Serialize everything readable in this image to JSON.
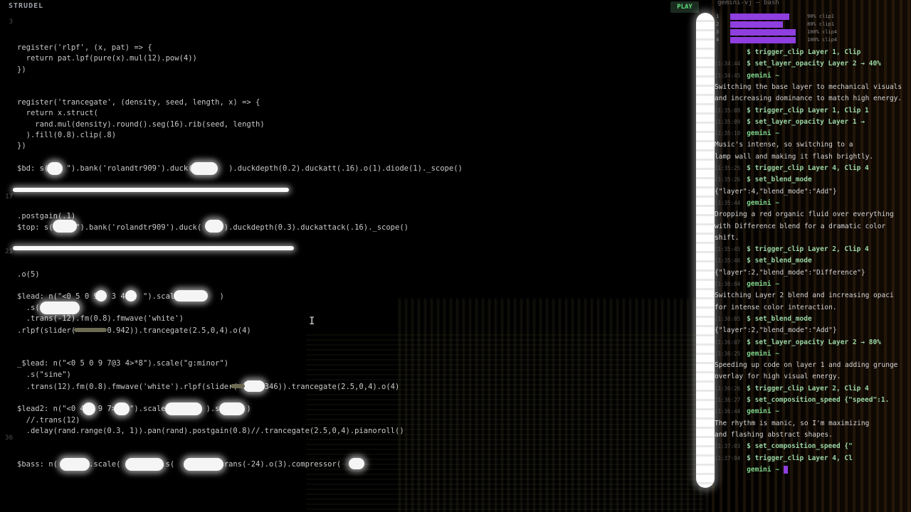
{
  "app": {
    "title": "STRUDEL",
    "play_label": "PLAY"
  },
  "terminal": {
    "title": "gemini-vj — bash",
    "meters": [
      {
        "num": "1",
        "value": 0.9,
        "label": "90% clip1"
      },
      {
        "num": "2",
        "value": 0.8,
        "label": "80% clip1"
      },
      {
        "num": "3",
        "value": 1.0,
        "label": "100% clip4"
      },
      {
        "num": "4",
        "value": 1.0,
        "label": "100% clip4"
      }
    ],
    "lines": [
      {
        "ts": "",
        "kind": "cmd",
        "text": "$ trigger_clip Layer 1, Clip"
      },
      {
        "ts": "11:34:44",
        "kind": "cmd",
        "text": "$ set_layer_opacity Layer 2 → 40%"
      },
      {
        "ts": "11:34:45",
        "kind": "prompt",
        "text": "gemini ~"
      },
      {
        "ts": "",
        "kind": "msg",
        "text": "Switching the base layer to mechanical visuals"
      },
      {
        "ts": "",
        "kind": "msg",
        "text": "and increasing dominance to match high energy."
      },
      {
        "ts": "11:35:08",
        "kind": "cmd",
        "text": "$ trigger_clip Layer 1, Clip 1"
      },
      {
        "ts": "11:35:09",
        "kind": "cmd",
        "text": "$ set_layer_opacity Layer 1 →"
      },
      {
        "ts": "11:35:10",
        "kind": "prompt",
        "text": "gemini ~"
      },
      {
        "ts": "",
        "kind": "msg",
        "text": "Music's intense, so switching to a"
      },
      {
        "ts": "",
        "kind": "msg",
        "text": "lamp wall and making it flash brightly."
      },
      {
        "ts": "11:35:25",
        "kind": "cmd",
        "text": "$ trigger_clip Layer 4, Clip 4"
      },
      {
        "ts": "11:35:26",
        "kind": "cmd",
        "text": "$ set_blend_mode"
      },
      {
        "ts": "",
        "kind": "msg",
        "text": "{\"layer\":4,\"blend_mode\":\"Add\"}"
      },
      {
        "ts": "11:35:44",
        "kind": "prompt",
        "text": "gemini ~"
      },
      {
        "ts": "",
        "kind": "msg",
        "text": "Dropping a red organic fluid over everything"
      },
      {
        "ts": "",
        "kind": "msg",
        "text": "with Difference blend for a dramatic color"
      },
      {
        "ts": "",
        "kind": "msg",
        "text": "shift."
      },
      {
        "ts": "11:35:45",
        "kind": "cmd",
        "text": "$ trigger_clip Layer 2, Clip 4"
      },
      {
        "ts": "11:35:46",
        "kind": "cmd",
        "text": "$ set_blend_mode"
      },
      {
        "ts": "",
        "kind": "msg",
        "text": "{\"layer\":2,\"blend_mode\":\"Difference\"}"
      },
      {
        "ts": "11:36:04",
        "kind": "prompt",
        "text": "gemini ~"
      },
      {
        "ts": "",
        "kind": "msg",
        "text": "Switching Layer 2 blend and increasing opaci"
      },
      {
        "ts": "",
        "kind": "msg",
        "text": "for intense color interaction."
      },
      {
        "ts": "11:36:05",
        "kind": "cmd",
        "text": "$ set_blend_mode"
      },
      {
        "ts": "",
        "kind": "msg",
        "text": "{\"layer\":2,\"blend_mode\":\"Add\"}"
      },
      {
        "ts": "11:36:07",
        "kind": "cmd",
        "text": "$ set_layer_opacity Layer 2 → 80%"
      },
      {
        "ts": "11:36:25",
        "kind": "prompt",
        "text": "gemini ~"
      },
      {
        "ts": "",
        "kind": "msg",
        "text": "Speeding up code on layer 1 and adding grunge"
      },
      {
        "ts": "",
        "kind": "msg",
        "text": "overlay for high visual energy."
      },
      {
        "ts": "11:36:26",
        "kind": "cmd",
        "text": "$ trigger_clip Layer 2, Clip 4"
      },
      {
        "ts": "11:36:27",
        "kind": "cmd",
        "text": "$ set_composition_speed {\"speed\":1."
      },
      {
        "ts": "11:36:44",
        "kind": "prompt",
        "text": "gemini ~"
      },
      {
        "ts": "",
        "kind": "msg",
        "text": "The rhythm is manic, so I'm maximizing"
      },
      {
        "ts": "",
        "kind": "msg",
        "text": "and flashing abstract shapes."
      },
      {
        "ts": "11:37:03",
        "kind": "cmd",
        "text": "$ set_composition_speed {\""
      },
      {
        "ts": "11:37:04",
        "kind": "cmd",
        "text": "$ trigger_clip Layer 4, Cl"
      },
      {
        "ts": "",
        "kind": "prompt",
        "text": "gemini ~"
      }
    ]
  },
  "editor": {
    "line_numbers": [
      "3",
      "",
      "",
      "",
      "",
      "",
      "",
      "",
      "",
      "",
      "",
      "",
      "",
      "",
      "",
      "",
      "17",
      "",
      "",
      "",
      "",
      "21",
      "",
      "",
      "",
      "",
      "",
      "",
      "",
      "",
      "",
      "",
      "",
      "",
      "",
      "",
      "",
      "",
      "36"
    ],
    "lines": [
      {
        "text": "register('rlpf', (x, pat) => {"
      },
      {
        "text": "  return pat.lpf(pure(x).mul(12).pow(4))"
      },
      {
        "text": "})"
      },
      {
        "text": "register('trancegate', (density, seed, length, x) => {"
      },
      {
        "text": "  return x.struct("
      },
      {
        "text": "    rand.mul(density).round().seg(16).rib(seed, length)"
      },
      {
        "text": "  ).fill(0.8).clip(.8)"
      },
      {
        "text": "})"
      },
      {
        "text": "$bd: s(    \").bank('rolandtr909').duck(        ).duckdepth(0.2).duckatt(.16).o(1).diode(1)._scope()"
      },
      {
        "text": ".postgain(.1)"
      },
      {
        "text": "$top: s(     \").bank('rolandtr909').duck(     ).duckdepth(0.3).duckattack(.16)._scope()"
      },
      {
        "text": ".o(5)"
      },
      {
        "text": "$lead: n(\"<0 5 0 9   3 4>*  \").scale(        )"
      },
      {
        "text": "  .s(        "
      },
      {
        "text": "  .trans(-12).fm(0.8).fmwave('white')"
      },
      {
        "text": ".rlpf(slider(       0.942)).trancegate(2.5,0,4).o(4)"
      },
      {
        "text": "_$lead: n(\"<0 5 0 9 7@3 4>*8\").scale(\"g:minor\")"
      },
      {
        "text": "  .s(\"sine\")"
      },
      {
        "text": "  .trans(12).fm(0.8).fmwave('white').rlpf(slider(    0.346)).trancegate(2.5,0,4).o(4)"
      },
      {
        "text": "$lead2: n(\"<0 4   9 7>   \").scale(        ).s(     )"
      },
      {
        "text": "  //.trans(12)"
      },
      {
        "text": "  .delay(rand.range(0.3, 1)).pan(rand).postgain(0.8)//.trancegate(2.5,0,4).pianoroll()"
      },
      {
        "text": "$bass: n(      ).scale(        ).s(        ).trans(-24).o(3).compressor(   )"
      }
    ]
  }
}
